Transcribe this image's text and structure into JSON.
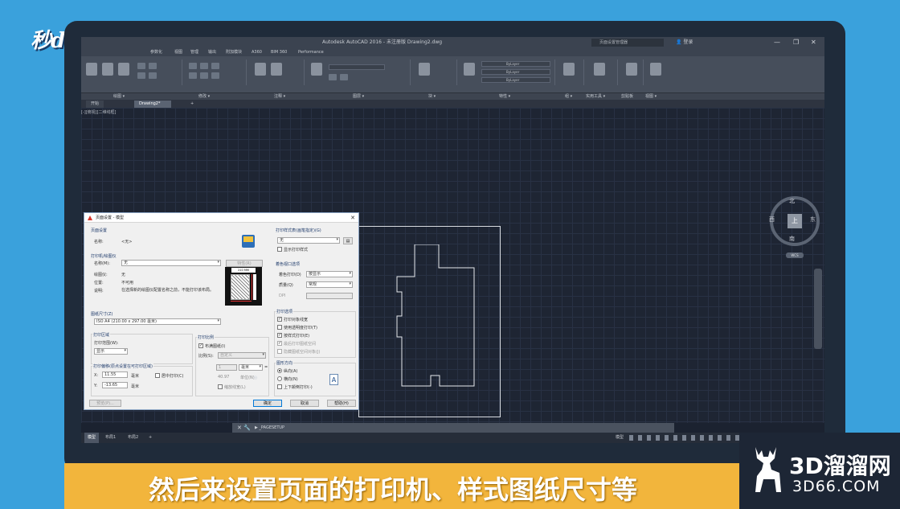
{
  "watermark": {
    "brand": "秒dong视频"
  },
  "app": {
    "title": "Autodesk AutoCAD 2016 - 未注册版    Drawing2.dwg",
    "search_placeholder": "页面设置管理器",
    "user": "登录",
    "window_controls": [
      "—",
      "❐",
      "✕"
    ],
    "menus": [
      "参数化",
      "视图",
      "管理",
      "输出",
      "附加模块",
      "A360",
      "BIM 360",
      "Performance"
    ],
    "panels": [
      "绘图 ▾",
      "修改 ▾",
      "注释 ▾",
      "图层 ▾",
      "块 ▾",
      "特性 ▾",
      "组 ▾",
      "实用工具 ▾",
      "剪贴板",
      "视图 ▾"
    ],
    "layer_dropdowns": [
      "ByLayer",
      "ByLayer",
      "ByLayer"
    ],
    "doc_tabs": [
      "开始",
      "Drawing2*",
      "+"
    ],
    "viewport_label": "[-][俯视][二维线框]",
    "compass": {
      "north": "北",
      "south": "南",
      "east": "东",
      "west": "西",
      "top": "上",
      "wcs": "WCS"
    },
    "command": "▶ _PAGESETUP",
    "layout_tabs": [
      "模型",
      "布局1",
      "布局2",
      "+"
    ],
    "status_mode": "模型"
  },
  "dialog": {
    "title": "页面设置 - 模型",
    "page_setup": {
      "heading": "页面设置",
      "name_label": "名称:",
      "name_value": "<无>",
      "printer_icon": "printer-icon"
    },
    "printer": {
      "heading": "打印机/绘图仪",
      "name_label": "名称(M):",
      "name_value": "无",
      "properties_btn": "特性(R)",
      "plotter_label": "绘图仪:",
      "plotter_value": "无",
      "location_label": "位置:",
      "location_value": "不可用",
      "desc_label": "说明:",
      "desc_value": "在选择新的绘图仪配置名称之前，不能打印该布局。",
      "preview_dim": "210 MM"
    },
    "paper_size": {
      "heading": "图纸尺寸(Z)",
      "value": "ISO A4 (210.00 x 297.00 毫米)"
    },
    "plot_area": {
      "heading": "打印区域",
      "range_label": "打印范围(W):",
      "range_value": "显示"
    },
    "plot_offset": {
      "heading": "打印偏移(原点设置在可打印区域)",
      "x_label": "X:",
      "x_value": "11.55",
      "y_label": "Y:",
      "y_value": "-13.65",
      "unit": "毫米",
      "center_label": "居中打印(C)"
    },
    "plot_scale": {
      "heading": "打印比例",
      "fit_label": "布满图纸(I)",
      "scale_label": "比例(S):",
      "scale_value": "自定义",
      "num": "1",
      "unit_value": "毫米",
      "unit_value2": "单位(N)",
      "eq": "=",
      "den": "40.97",
      "lineweight_label": "缩放线宽(L)"
    },
    "plot_style": {
      "heading": "打印样式表(画笔指定)(G)",
      "value": "无",
      "show_label": "显示打印样式"
    },
    "shaded": {
      "heading": "着色视口选项",
      "shade_label": "着色打印(D)",
      "shade_value": "按显示",
      "quality_label": "质量(Q)",
      "quality_value": "常规",
      "dpi_label": "DPI"
    },
    "options": {
      "heading": "打印选项",
      "items": [
        "打印对象线宽",
        "使用透明度打印(T)",
        "按样式打印(E)",
        "最后打印图纸空间",
        "隐藏图纸空间对象(J)"
      ]
    },
    "orientation": {
      "heading": "图形方向",
      "portrait": "纵向(A)",
      "landscape": "横向(N)",
      "upside": "上下颠倒打印(-)",
      "icon_letter": "A"
    },
    "buttons": {
      "preview": "预览(P)...",
      "ok": "确定",
      "cancel": "取消",
      "help": "帮助(H)"
    }
  },
  "caption": "然后来设置页面的打印机、样式图纸尺寸等",
  "logo": {
    "line1": "3D溜溜网",
    "line2": "3D66.COM"
  }
}
